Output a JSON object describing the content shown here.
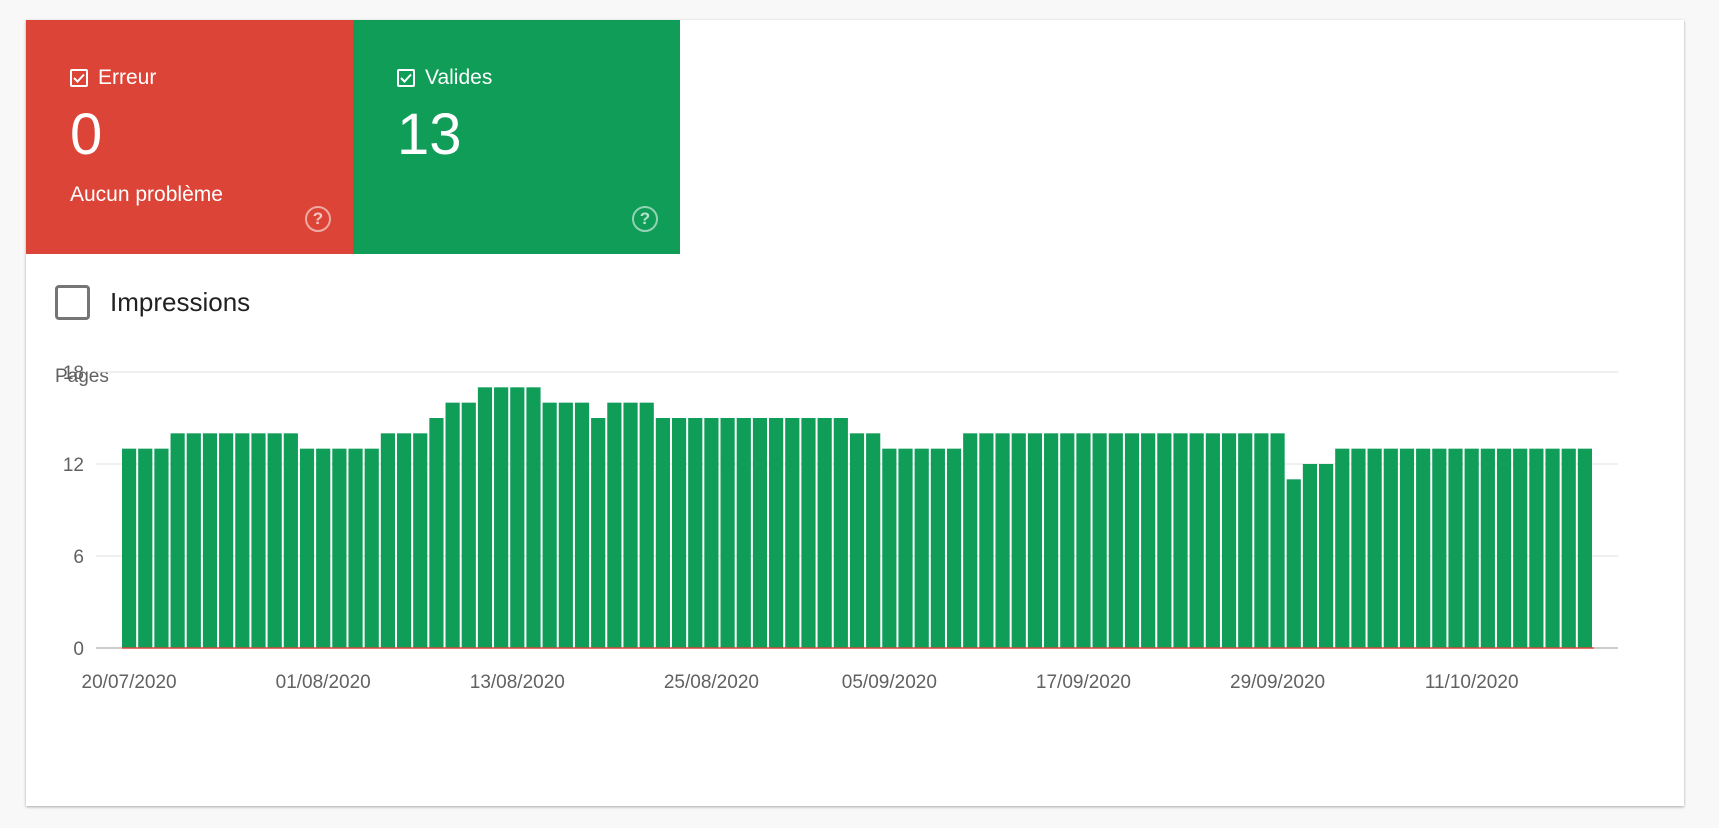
{
  "tiles": {
    "error": {
      "label": "Erreur",
      "count": "0",
      "sub": "Aucun problème",
      "color": "#db4437",
      "checked": true
    },
    "valid": {
      "label": "Valides",
      "count": "13",
      "sub": "",
      "color": "#0f9d58",
      "checked": true
    }
  },
  "metric_toggle": {
    "label": "Impressions",
    "checked": false
  },
  "chart_data": {
    "type": "bar",
    "ylabel": "Pages",
    "ylim": [
      0,
      18
    ],
    "yticks": [
      0,
      6,
      12,
      18
    ],
    "grid": true,
    "xticks": [
      "20/07/2020",
      "01/08/2020",
      "13/08/2020",
      "25/08/2020",
      "05/09/2020",
      "17/09/2020",
      "29/09/2020",
      "11/10/2020"
    ],
    "x_start": "20/07/2020",
    "x_end": "19/10/2020",
    "series": [
      {
        "name": "Erreur",
        "color": "#db4437",
        "values": [
          0,
          0,
          0,
          0,
          0,
          0,
          0,
          0,
          0,
          0,
          0,
          0,
          0,
          0,
          0,
          0,
          0,
          0,
          0,
          0,
          0,
          0,
          0,
          0,
          0,
          0,
          0,
          0,
          0,
          0,
          0,
          0,
          0,
          0,
          0,
          0,
          0,
          0,
          0,
          0,
          0,
          0,
          0,
          0,
          0,
          0,
          0,
          0,
          0,
          0,
          0,
          0,
          0,
          0,
          0,
          0,
          0,
          0,
          0,
          0,
          0,
          0,
          0,
          0,
          0,
          0,
          0,
          0,
          0,
          0,
          0,
          0,
          0,
          0,
          0,
          0,
          0,
          0,
          0,
          0,
          0,
          0,
          0,
          0,
          0,
          0,
          0,
          0,
          0,
          0,
          0
        ]
      },
      {
        "name": "Valides",
        "color": "#0f9d58",
        "values": [
          13,
          13,
          13,
          14,
          14,
          14,
          14,
          14,
          14,
          14,
          14,
          13,
          13,
          13,
          13,
          13,
          14,
          14,
          14,
          15,
          16,
          16,
          17,
          17,
          17,
          17,
          16,
          16,
          16,
          15,
          16,
          16,
          16,
          15,
          15,
          15,
          15,
          15,
          15,
          15,
          15,
          15,
          15,
          15,
          15,
          14,
          14,
          13,
          13,
          13,
          13,
          13,
          14,
          14,
          14,
          14,
          14,
          14,
          14,
          14,
          14,
          14,
          14,
          14,
          14,
          14,
          14,
          14,
          14,
          14,
          14,
          14,
          11,
          12,
          12,
          13,
          13,
          13,
          13,
          13,
          13,
          13,
          13,
          13,
          13,
          13,
          13,
          13,
          13,
          13,
          13
        ]
      }
    ]
  }
}
